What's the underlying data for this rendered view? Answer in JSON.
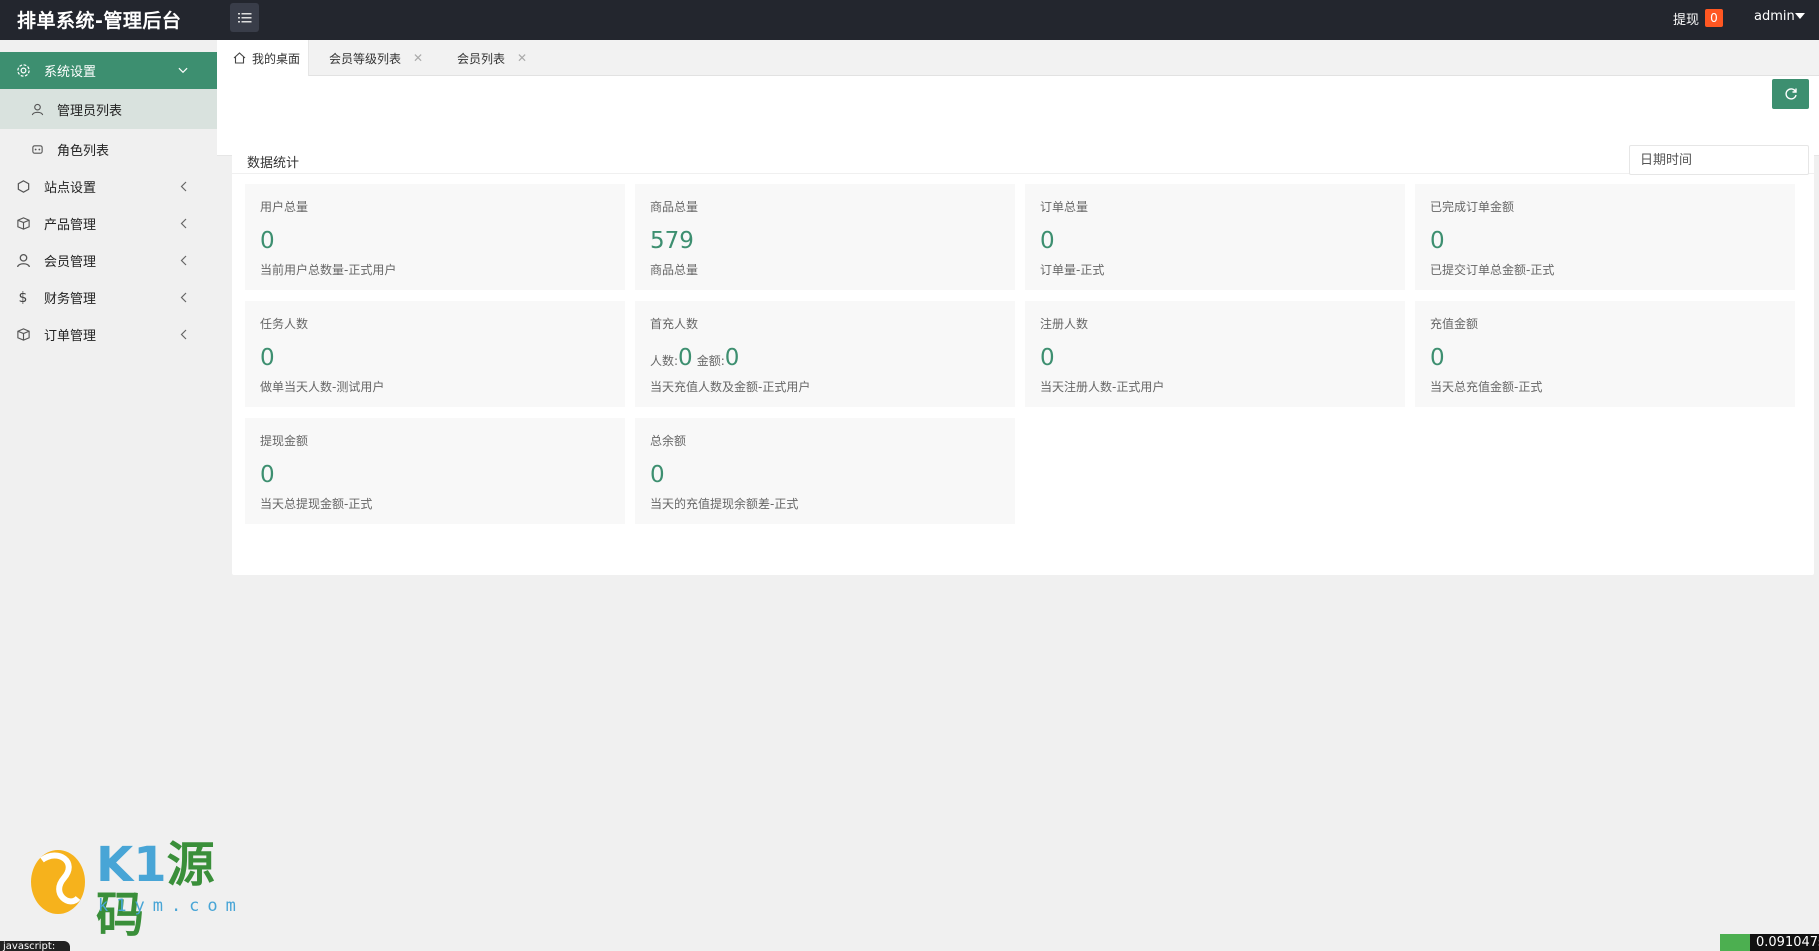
{
  "header": {
    "brand": "排单系统-管理后台",
    "withdraw_label": "提现",
    "withdraw_count": "0",
    "user_name": "admin"
  },
  "sidebar": {
    "items": [
      {
        "label": "系统设置",
        "icon": "gear-icon",
        "expanded": true
      },
      {
        "label": "站点设置",
        "icon": "site-icon"
      },
      {
        "label": "产品管理",
        "icon": "box-icon"
      },
      {
        "label": "会员管理",
        "icon": "user-icon"
      },
      {
        "label": "财务管理",
        "icon": "dollar-icon"
      },
      {
        "label": "订单管理",
        "icon": "box-icon"
      }
    ],
    "sub_items": [
      {
        "label": "管理员列表",
        "icon": "user-icon"
      },
      {
        "label": "角色列表",
        "icon": "role-icon"
      }
    ]
  },
  "tabs": [
    {
      "label": "我的桌面",
      "icon": "home-icon"
    },
    {
      "label": "会员等级列表"
    },
    {
      "label": "会员列表"
    }
  ],
  "panel": {
    "title": "数据统计",
    "date_placeholder": "日期时间"
  },
  "cards": [
    {
      "title": "用户总量",
      "value": "0",
      "desc": "当前用户总数量-正式用户"
    },
    {
      "title": "商品总量",
      "value": "579",
      "desc": "商品总量"
    },
    {
      "title": "订单总量",
      "value": "0",
      "desc": "订单量-正式"
    },
    {
      "title": "已完成订单金额",
      "value": "0",
      "desc": "已提交订单总金额-正式"
    },
    {
      "title": "任务人数",
      "value": "0",
      "desc": "做单当天人数-测试用户"
    },
    {
      "title": "首充人数",
      "count_label": "人数:",
      "count_value": "0",
      "amount_label": "金额:",
      "amount_value": "0",
      "desc": "当天充值人数及金额-正式用户"
    },
    {
      "title": "注册人数",
      "value": "0",
      "desc": "当天注册人数-正式用户"
    },
    {
      "title": "充值金额",
      "value": "0",
      "desc": "当天总充值金额-正式"
    },
    {
      "title": "提现金额",
      "value": "0",
      "desc": "当天总提现金额-正式"
    },
    {
      "title": "总余额",
      "value": "0",
      "desc": "当天的充值提现余额差-正式"
    }
  ],
  "watermark": {
    "brand_prefix": "K1",
    "brand_suffix": "源码",
    "domain": "k1ym.com"
  },
  "footer": {
    "js_label": "javascript:",
    "timing": "0.091047s"
  },
  "colors": {
    "accent": "#3d8f70",
    "header_bg": "#23262e",
    "badge": "#ff5722"
  }
}
